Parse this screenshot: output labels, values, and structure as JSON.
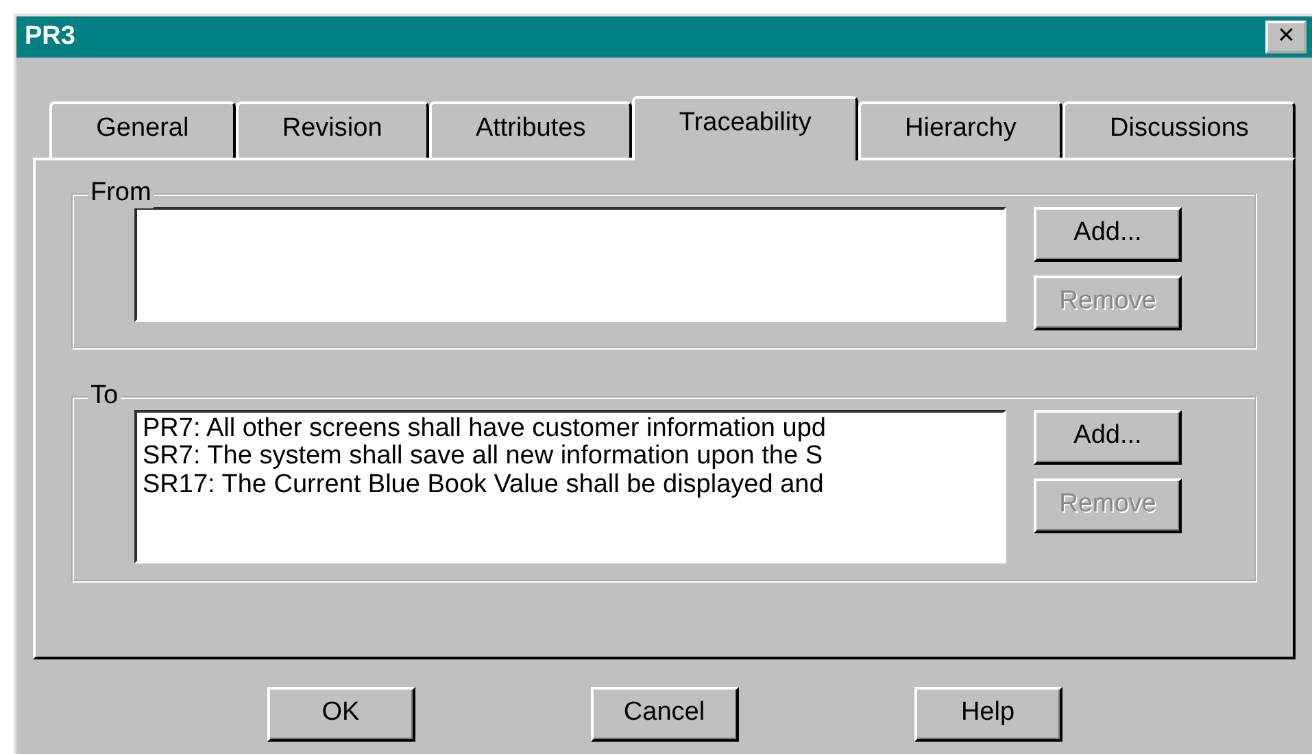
{
  "window": {
    "title": "PR3",
    "close": "✕"
  },
  "tabs": [
    {
      "label": "General",
      "selected": false
    },
    {
      "label": "Revision",
      "selected": false
    },
    {
      "label": "Attributes",
      "selected": false
    },
    {
      "label": "Traceability",
      "selected": true
    },
    {
      "label": "Hierarchy",
      "selected": false
    },
    {
      "label": "Discussions",
      "selected": false
    }
  ],
  "groups": [
    {
      "label": "From",
      "buttons": [
        {
          "label": "Add...",
          "disabled": false
        },
        {
          "label": "Remove",
          "disabled": true
        }
      ]
    },
    {
      "label": "To",
      "items": [
        "PR7: All other screens shall have customer information upd",
        "SR7: The system shall save all new information upon the S",
        "SR17: The Current Blue Book Value shall be displayed and"
      ],
      "buttons": [
        {
          "label": "Add...",
          "disabled": false
        },
        {
          "label": "Remove",
          "disabled": true
        }
      ]
    }
  ],
  "buttons": [
    "OK",
    "Cancel",
    "Help"
  ]
}
